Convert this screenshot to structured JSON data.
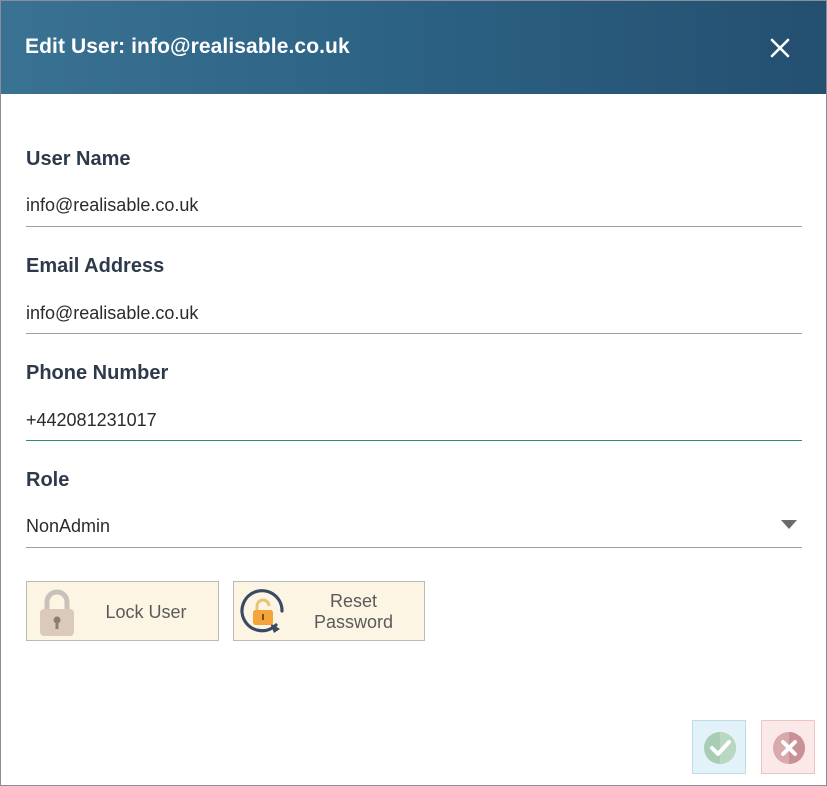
{
  "dialog": {
    "title": "Edit User: info@realisable.co.uk"
  },
  "fields": {
    "user_name": {
      "label": "User Name",
      "value": "info@realisable.co.uk"
    },
    "email": {
      "label": "Email Address",
      "value": "info@realisable.co.uk"
    },
    "phone": {
      "label": "Phone Number",
      "value": "+442081231017"
    },
    "role": {
      "label": "Role",
      "value": "NonAdmin"
    }
  },
  "actions": {
    "lock_user": "Lock User",
    "reset_password_line1": "Reset",
    "reset_password_line2": "Password"
  },
  "icons": {
    "close": "close-icon",
    "lock": "padlock-icon",
    "reset": "reset-password-icon",
    "ok": "checkmark-icon",
    "cancel": "cancel-x-icon",
    "dropdown": "chevron-down-icon"
  },
  "colors": {
    "header_start": "#3a7294",
    "header_end": "#244f70",
    "active_underline": "#2f8f6f",
    "action_button_bg": "#fdf5e4",
    "ok_bg": "#e3f1f8",
    "cancel_bg": "#fbe8e8"
  }
}
